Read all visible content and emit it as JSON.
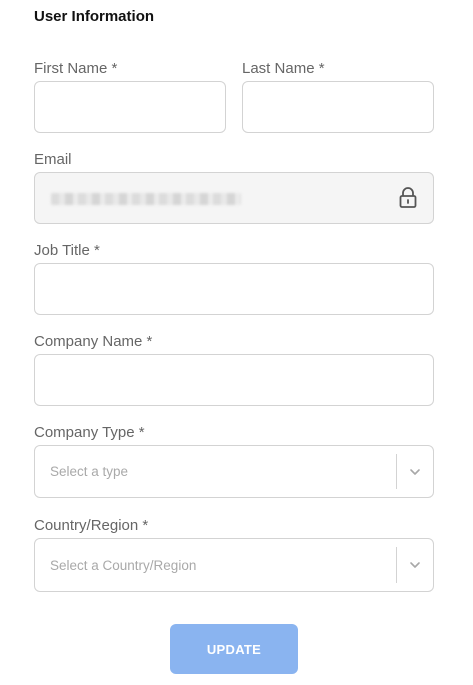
{
  "section": {
    "title": "User Information"
  },
  "fields": {
    "first_name": {
      "label": "First Name *",
      "value": ""
    },
    "last_name": {
      "label": "Last Name *",
      "value": ""
    },
    "email": {
      "label": "Email",
      "icon": "lock-icon"
    },
    "job_title": {
      "label": "Job Title *",
      "value": ""
    },
    "company_name": {
      "label": "Company Name *",
      "value": ""
    },
    "company_type": {
      "label": "Company Type *",
      "placeholder": "Select a type",
      "icon": "chevron-down-icon"
    },
    "country_region": {
      "label": "Country/Region *",
      "placeholder": "Select a Country/Region",
      "icon": "chevron-down-icon"
    }
  },
  "actions": {
    "update_label": "UPDATE",
    "update_color": "#8ab4f0"
  }
}
